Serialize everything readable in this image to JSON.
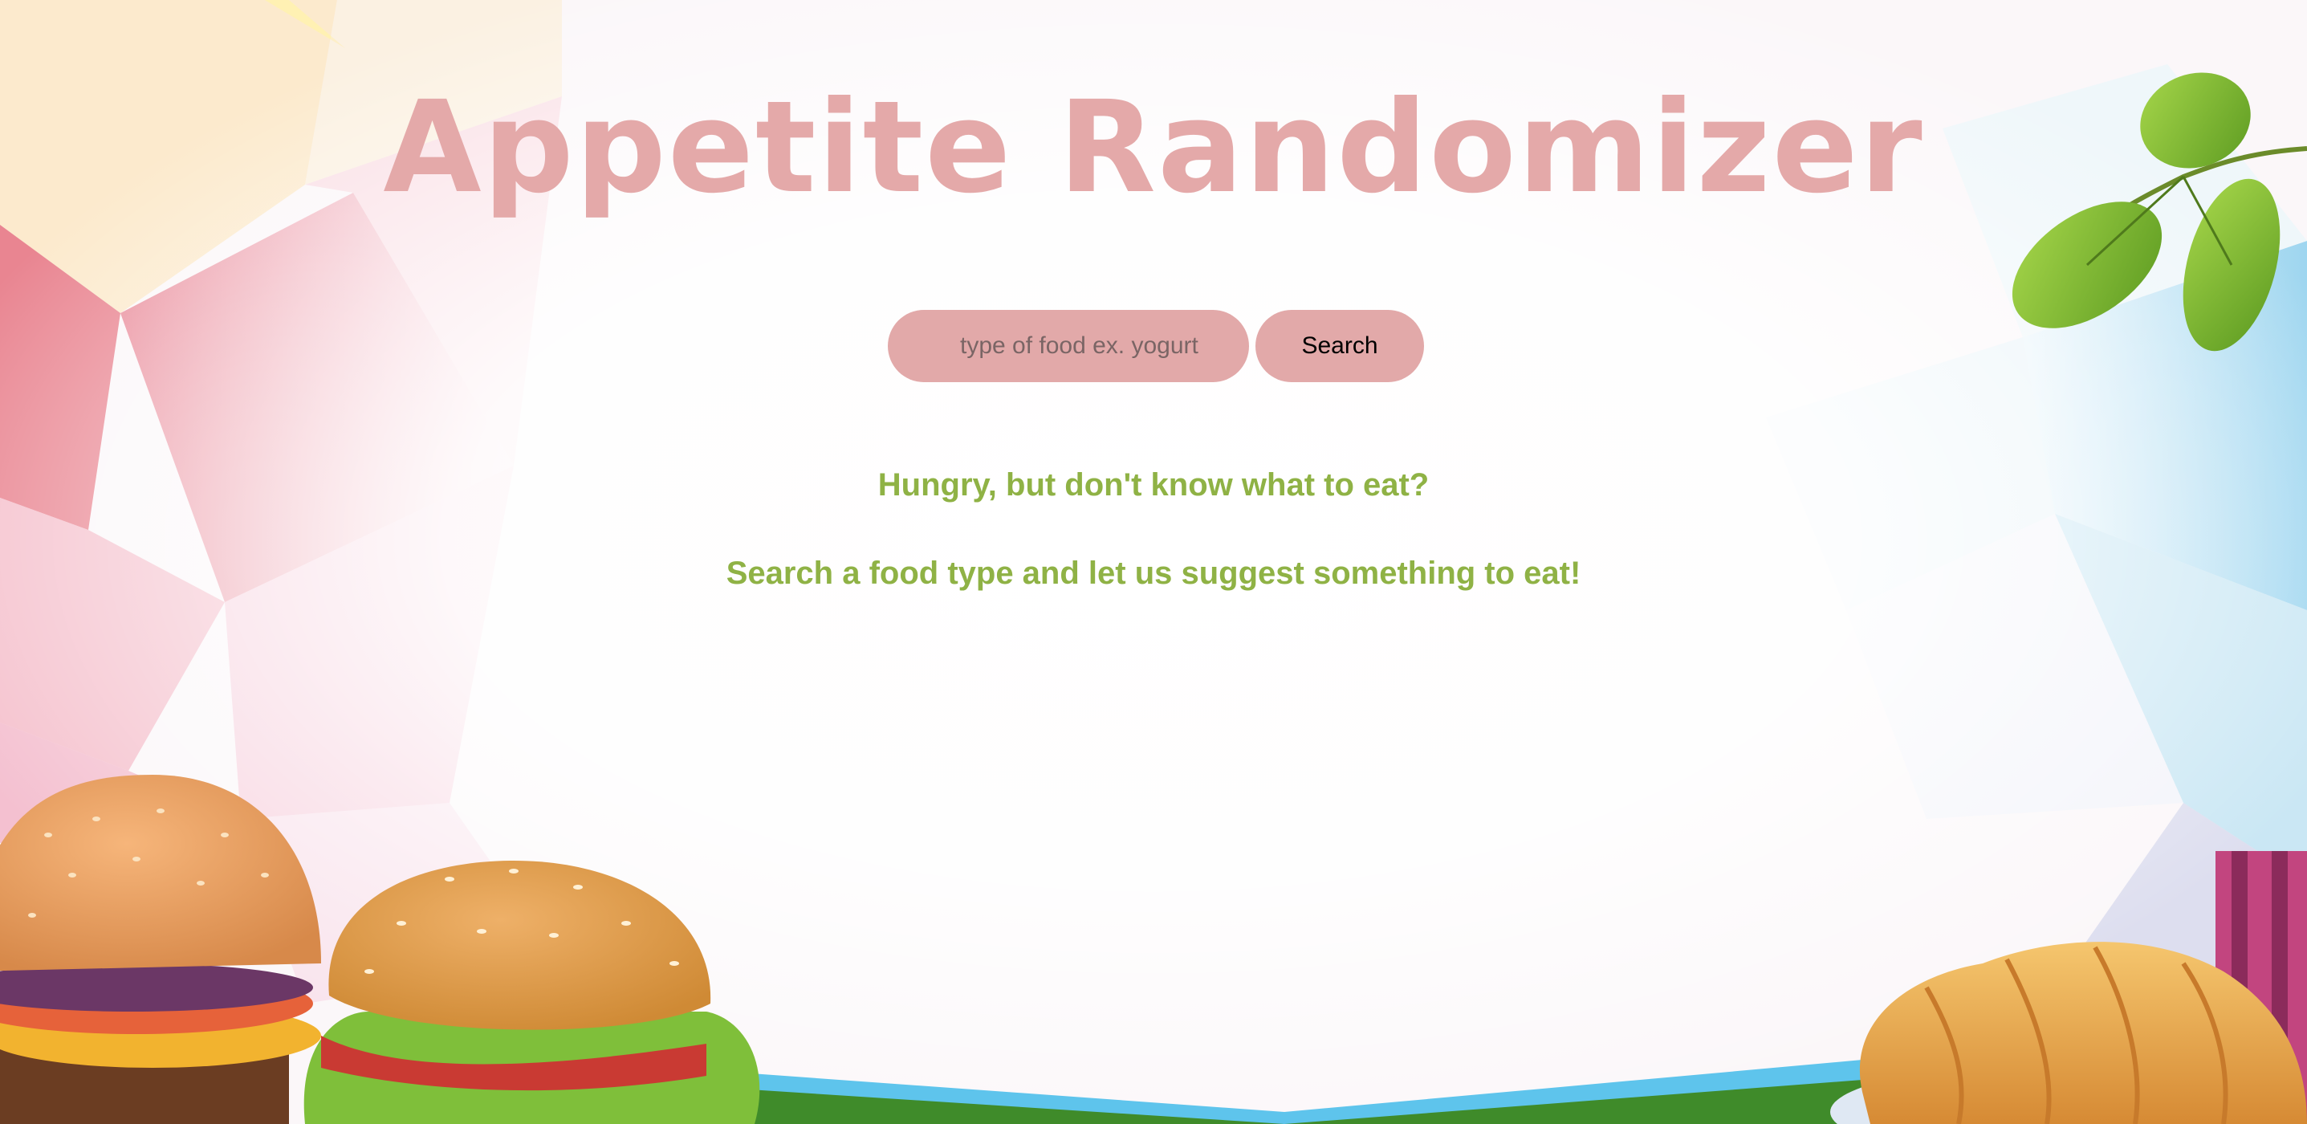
{
  "header": {
    "title": "Appetite Randomizer"
  },
  "search": {
    "placeholder": "type of food ex. yogurt",
    "value": "",
    "button_label": "Search"
  },
  "intro": {
    "line1": "Hungry, but don't know what to eat?",
    "line2": "Search a food type and let us suggest something to eat!"
  },
  "decorations": {
    "background": "polygon-pastel-backdrop",
    "items": [
      "leaf-branch-icon",
      "burger-icon",
      "burger-with-lettuce-icon",
      "croissant-icon",
      "picnic-basket-icon"
    ]
  },
  "colors": {
    "title": "#e4a9a9",
    "input_bg": "#e2a9a9",
    "button_bg": "#e2a9a9",
    "intro_text": "#8fb245",
    "ground_green": "#3f8b2a",
    "ground_blue": "#5ec4ec"
  }
}
